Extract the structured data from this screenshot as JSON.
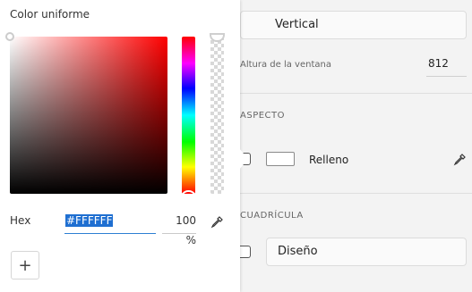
{
  "popover": {
    "title": "Color uniforme",
    "hex_label": "Hex",
    "hex_value": "#FFFFFF",
    "opacity_value": "100 %",
    "add_symbol": "+"
  },
  "inspector": {
    "orientation_value": "Vertical",
    "window_height_label": "Altura de la ventana",
    "window_height_value": "812",
    "appearance_section": "ASPECTO",
    "fill_label": "Relleno",
    "grid_section": "CUADRÍCULA",
    "grid_dropdown_value": "Diseño"
  },
  "colors": {
    "accent": "#1f6fd1",
    "fill_swatch": "#FFFFFF"
  }
}
